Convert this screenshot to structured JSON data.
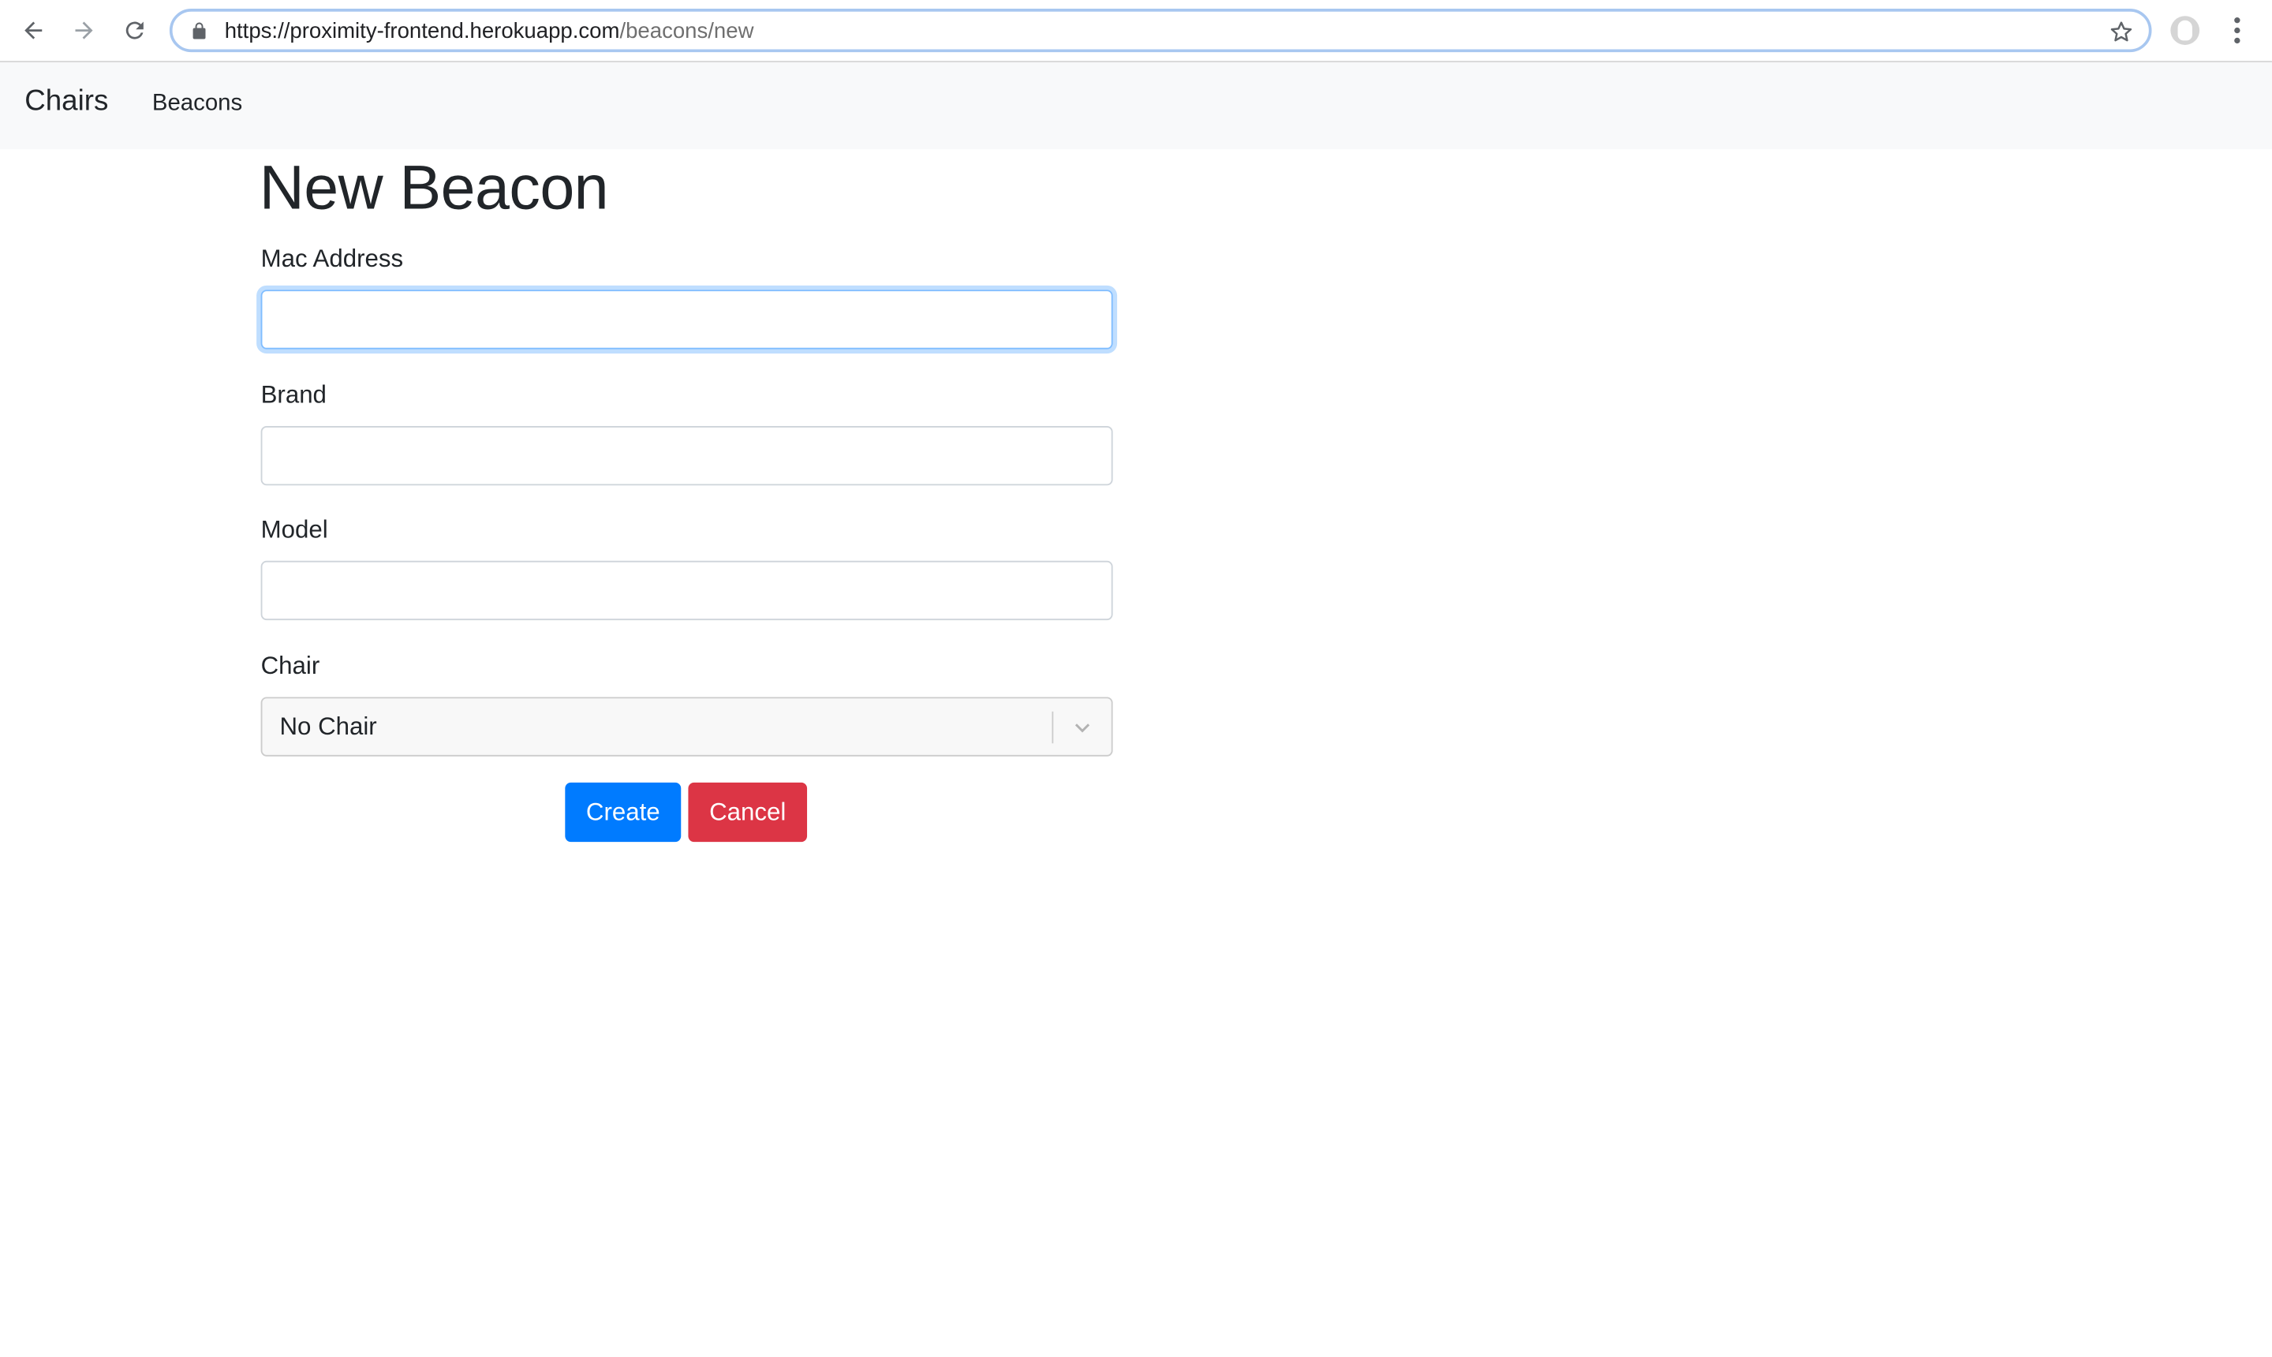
{
  "browser": {
    "url_host": "https://proximity-frontend.herokuapp.com",
    "url_path": "/beacons/new"
  },
  "navbar": {
    "brand": "Chairs",
    "links": [
      {
        "label": "Beacons"
      }
    ]
  },
  "form": {
    "title": "New Beacon",
    "fields": [
      {
        "label": "Mac Address",
        "value": "",
        "placeholder": ""
      },
      {
        "label": "Brand",
        "value": "",
        "placeholder": ""
      },
      {
        "label": "Model",
        "value": "",
        "placeholder": ""
      }
    ],
    "chair": {
      "label": "Chair",
      "selected": "No Chair"
    },
    "create_label": "Create",
    "cancel_label": "Cancel"
  },
  "colors": {
    "primary": "#007bff",
    "danger": "#dc3545",
    "navbar_bg": "#f8f9fa",
    "focus_ring": "#80bdff"
  },
  "icons": [
    "back-arrow-icon",
    "forward-arrow-icon",
    "reload-icon",
    "lock-icon",
    "star-icon",
    "profile-icon",
    "menu-dots-icon",
    "chevron-down-icon"
  ]
}
